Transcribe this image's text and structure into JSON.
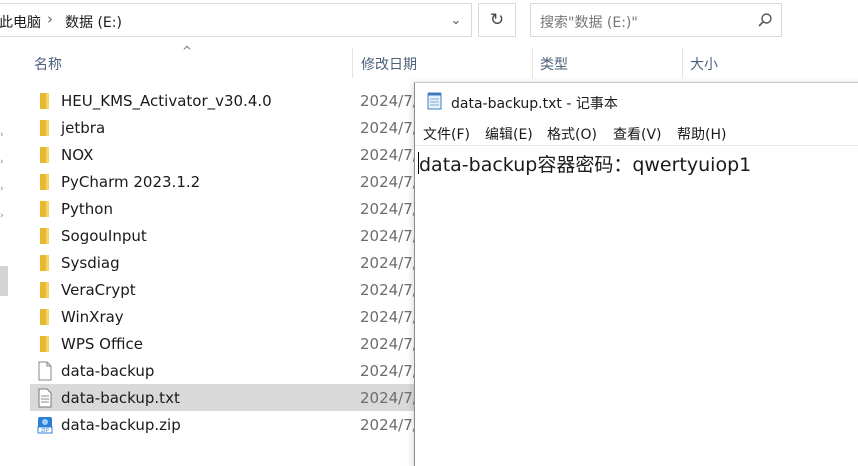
{
  "explorer": {
    "breadcrumb": {
      "root": "此电脑",
      "drive": "数据 (E:)"
    },
    "search_placeholder": "搜索\"数据 (E:)\"",
    "columns": {
      "name": "名称",
      "modified": "修改日期",
      "type": "类型",
      "size": "大小"
    },
    "files": [
      {
        "name": "HEU_KMS_Activator_v30.4.0",
        "date": "2024/7/",
        "icon": "folder-icon",
        "selected": false
      },
      {
        "name": "jetbra",
        "date": "2024/7/",
        "icon": "folder-icon",
        "selected": false
      },
      {
        "name": "NOX",
        "date": "2024/7/",
        "icon": "folder-icon",
        "selected": false
      },
      {
        "name": "PyCharm 2023.1.2",
        "date": "2024/7/",
        "icon": "folder-icon",
        "selected": false
      },
      {
        "name": "Python",
        "date": "2024/7/",
        "icon": "folder-icon",
        "selected": false
      },
      {
        "name": "SogouInput",
        "date": "2024/7/",
        "icon": "folder-icon",
        "selected": false
      },
      {
        "name": "Sysdiag",
        "date": "2024/7/",
        "icon": "folder-icon",
        "selected": false
      },
      {
        "name": "VeraCrypt",
        "date": "2024/7/",
        "icon": "folder-icon",
        "selected": false
      },
      {
        "name": "WinXray",
        "date": "2024/7/",
        "icon": "folder-icon",
        "selected": false
      },
      {
        "name": "WPS Office",
        "date": "2024/7/",
        "icon": "folder-icon",
        "selected": false
      },
      {
        "name": "data-backup",
        "date": "2024/7/",
        "icon": "blank-file-icon",
        "selected": false
      },
      {
        "name": "data-backup.txt",
        "date": "2024/7/",
        "icon": "text-file-icon",
        "selected": true
      },
      {
        "name": "data-backup.zip",
        "date": "2024/7/",
        "icon": "zip-file-icon",
        "selected": false
      }
    ]
  },
  "notepad": {
    "title": "data-backup.txt - 记事本",
    "menu": [
      "文件(F)",
      "编辑(E)",
      "格式(O)",
      "查看(V)",
      "帮助(H)"
    ],
    "content": "data-backup容器密码：qwertyuiop1"
  },
  "colors": {
    "folder": "#f0c040",
    "selected_row": "#d9d9d9",
    "header_text": "#4c607a"
  }
}
